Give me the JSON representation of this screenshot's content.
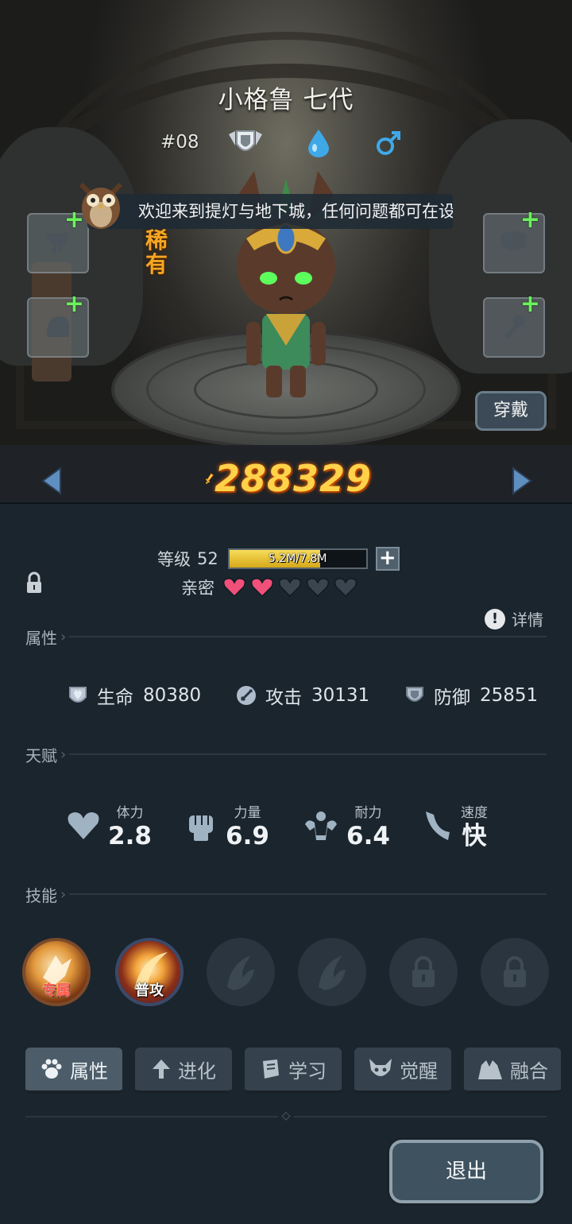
{
  "character": {
    "name": "小格鲁 七代",
    "number": "#08",
    "rarity": "稀有",
    "power": "288329"
  },
  "toast": {
    "text": "欢迎来到提灯与地下城，任何问题都可在设置"
  },
  "buttons": {
    "wear": "穿戴",
    "exit": "退出"
  },
  "level": {
    "label": "等级",
    "value": "52",
    "xp_text": "5.2M/7.8M",
    "xp_fraction": 0.667
  },
  "intimacy": {
    "label": "亲密",
    "filled": 2,
    "total": 5
  },
  "detail_label": "详情",
  "sections": {
    "attributes": "属性",
    "talents": "天赋",
    "skills": "技能"
  },
  "attributes": [
    {
      "icon": "heart-shield-icon",
      "label": "生命",
      "value": "80380"
    },
    {
      "icon": "sword-icon",
      "label": "攻击",
      "value": "30131"
    },
    {
      "icon": "shield-icon",
      "label": "防御",
      "value": "25851"
    }
  ],
  "talents": [
    {
      "icon": "heart-icon",
      "label": "体力",
      "value": "2.8"
    },
    {
      "icon": "fist-icon",
      "label": "力量",
      "value": "6.9"
    },
    {
      "icon": "muscle-icon",
      "label": "耐力",
      "value": "6.4"
    },
    {
      "icon": "wing-icon",
      "label": "速度",
      "value": "快"
    }
  ],
  "skills": [
    {
      "state": "active",
      "tag": "专属"
    },
    {
      "state": "active",
      "tag": "普攻"
    },
    {
      "state": "empty",
      "tag": ""
    },
    {
      "state": "empty",
      "tag": ""
    },
    {
      "state": "locked",
      "tag": ""
    },
    {
      "state": "locked",
      "tag": ""
    }
  ],
  "tabs": [
    {
      "icon": "paw-icon",
      "label": "属性",
      "active": true
    },
    {
      "icon": "evolve-arrow-icon",
      "label": "进化",
      "active": false
    },
    {
      "icon": "book-icon",
      "label": "学习",
      "active": false
    },
    {
      "icon": "demon-icon",
      "label": "觉醒",
      "active": false
    },
    {
      "icon": "fusion-icon",
      "label": "融合",
      "active": false
    }
  ],
  "colors": {
    "power": "#ffd24a",
    "rarity": "#f5a623",
    "equip_plus": "#6bf25c",
    "heart_filled": "#f0507a",
    "heart_empty": "#3a4550",
    "xp_fill": "#e9c42f"
  }
}
